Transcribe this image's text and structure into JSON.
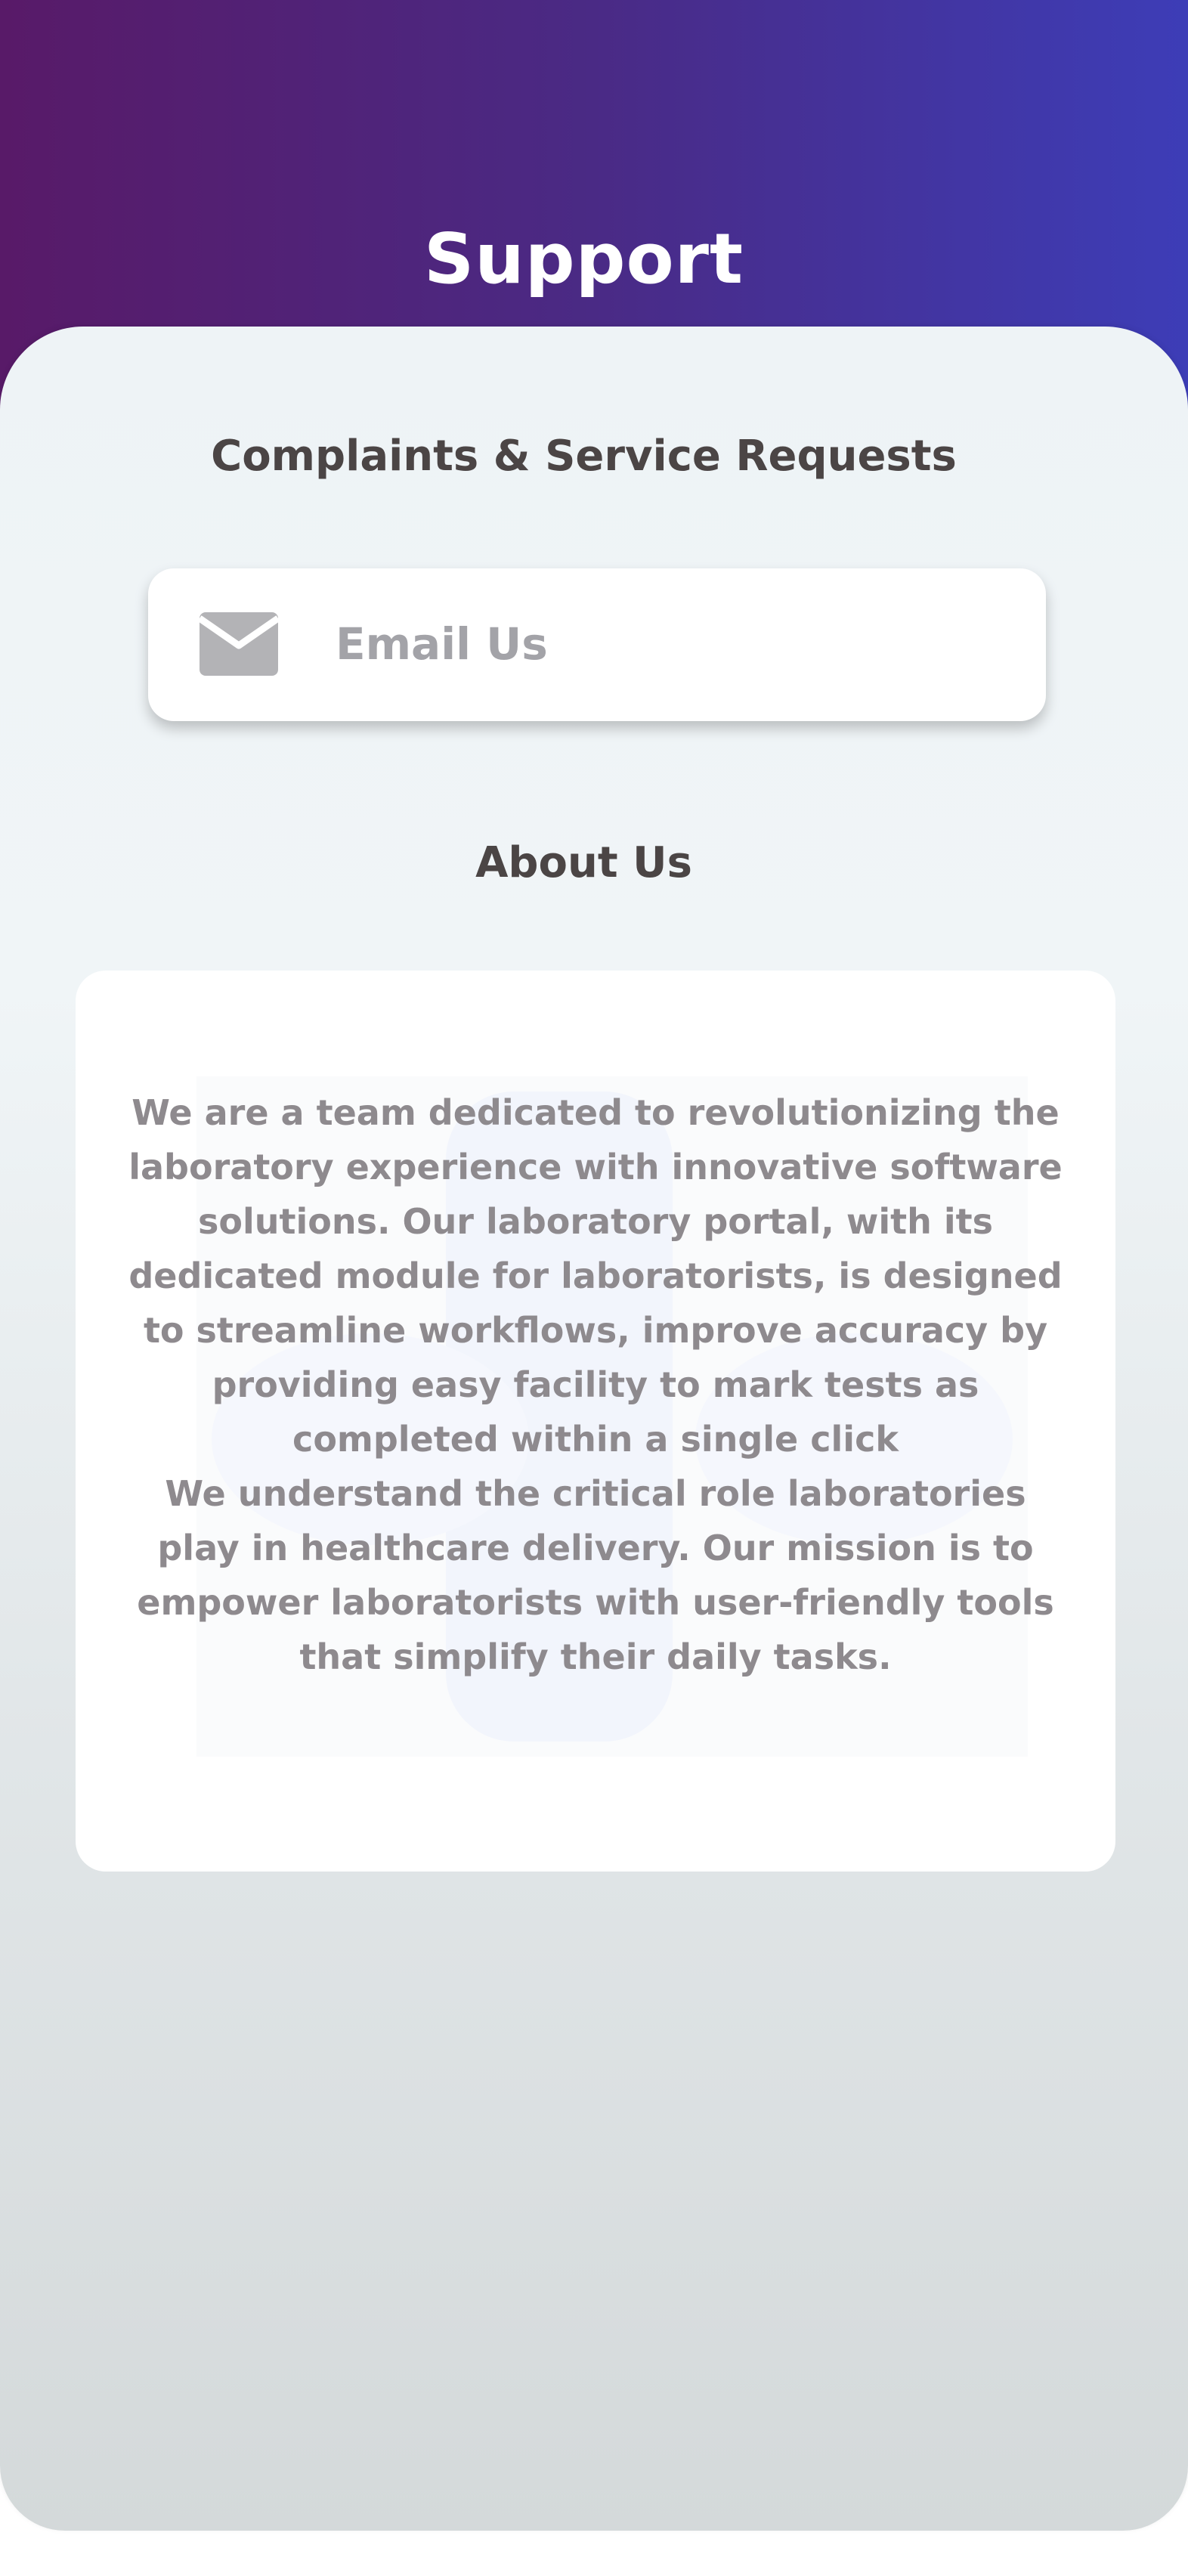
{
  "header": {
    "title": "Support"
  },
  "complaints": {
    "heading": "Complaints & Service Requests",
    "email_label": "Email Us",
    "email_icon": "envelope-icon"
  },
  "about": {
    "heading": "About Us",
    "paragraph1": "We are a team dedicated to revolutionizing the laboratory experience with innovative software solutions. Our laboratory portal, with its dedicated module for laboratorists, is designed to streamline workflows, improve accuracy by providing easy facility to mark tests as completed within a single click",
    "paragraph2": "We understand the critical role laboratories play in healthcare delivery.  Our mission is to empower laboratorists with user-friendly tools that simplify their daily tasks."
  },
  "colors": {
    "header_gradient_start": "#581a68",
    "header_gradient_end": "#3d3db7",
    "heading_text": "#4b4545",
    "body_text": "#8e8a8e",
    "icon_gray": "#b3b3b6"
  }
}
